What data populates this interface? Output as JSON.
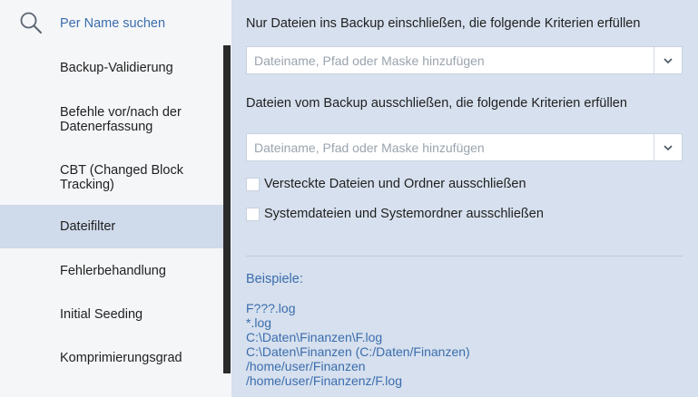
{
  "sidebar": {
    "search_label": "Per Name suchen",
    "items": [
      {
        "label": "Backup-Validierung",
        "active": false
      },
      {
        "label": "Befehle vor/nach der Datenerfassung",
        "active": false
      },
      {
        "label": "CBT (Changed Block Tracking)",
        "active": false
      },
      {
        "label": "Dateifilter",
        "active": true
      },
      {
        "label": "Fehlerbehandlung",
        "active": false
      },
      {
        "label": "Initial Seeding",
        "active": false
      },
      {
        "label": "Komprimierungsgrad",
        "active": false
      }
    ]
  },
  "main": {
    "include_label": "Nur Dateien ins Backup einschließen, die folgende Kriterien erfüllen",
    "include_placeholder": "Dateiname, Pfad oder Maske hinzufügen",
    "exclude_label": "Dateien vom Backup ausschließen, die folgende Kriterien erfüllen",
    "exclude_placeholder": "Dateiname, Pfad oder Maske hinzufügen",
    "checkbox_hidden": {
      "label": "Versteckte Dateien und Ordner ausschließen",
      "checked": false
    },
    "checkbox_system": {
      "label": "Systemdateien und Systemordner ausschließen",
      "checked": false
    },
    "examples_title": "Beispiele:",
    "examples": [
      "F???.log",
      "*.log",
      "C:\\Daten\\Finanzen\\F.log",
      "C:\\Daten\\Finanzen (C:/Daten/Finanzen)",
      "/home/user/Finanzen",
      "/home/user/Finanzenz/F.log"
    ]
  },
  "colors": {
    "accent": "#3b6dad",
    "main_background": "#d6e0ee",
    "sidebar_background": "#f5f6f8",
    "active_item": "#cfdaeb"
  }
}
